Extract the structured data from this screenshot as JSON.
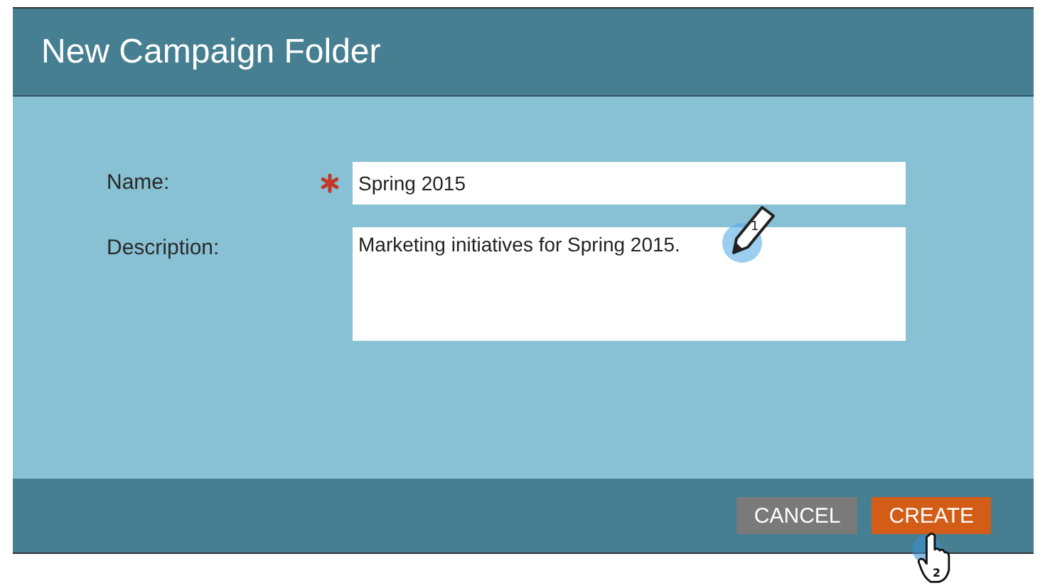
{
  "dialog": {
    "title": "New Campaign Folder"
  },
  "fields": [
    {
      "kind": "input",
      "label": "Name:",
      "required": true,
      "value": "Spring 2015"
    },
    {
      "kind": "textarea",
      "label": "Description:",
      "required": false,
      "value": "Marketing initiatives for Spring 2015."
    }
  ],
  "buttons": [
    {
      "label": "CANCEL",
      "kind": "secondary"
    },
    {
      "label": "CREATE",
      "kind": "primary"
    }
  ],
  "callouts": [
    {
      "kind": "pencil",
      "number": "1"
    },
    {
      "kind": "hand",
      "number": "2"
    }
  ]
}
